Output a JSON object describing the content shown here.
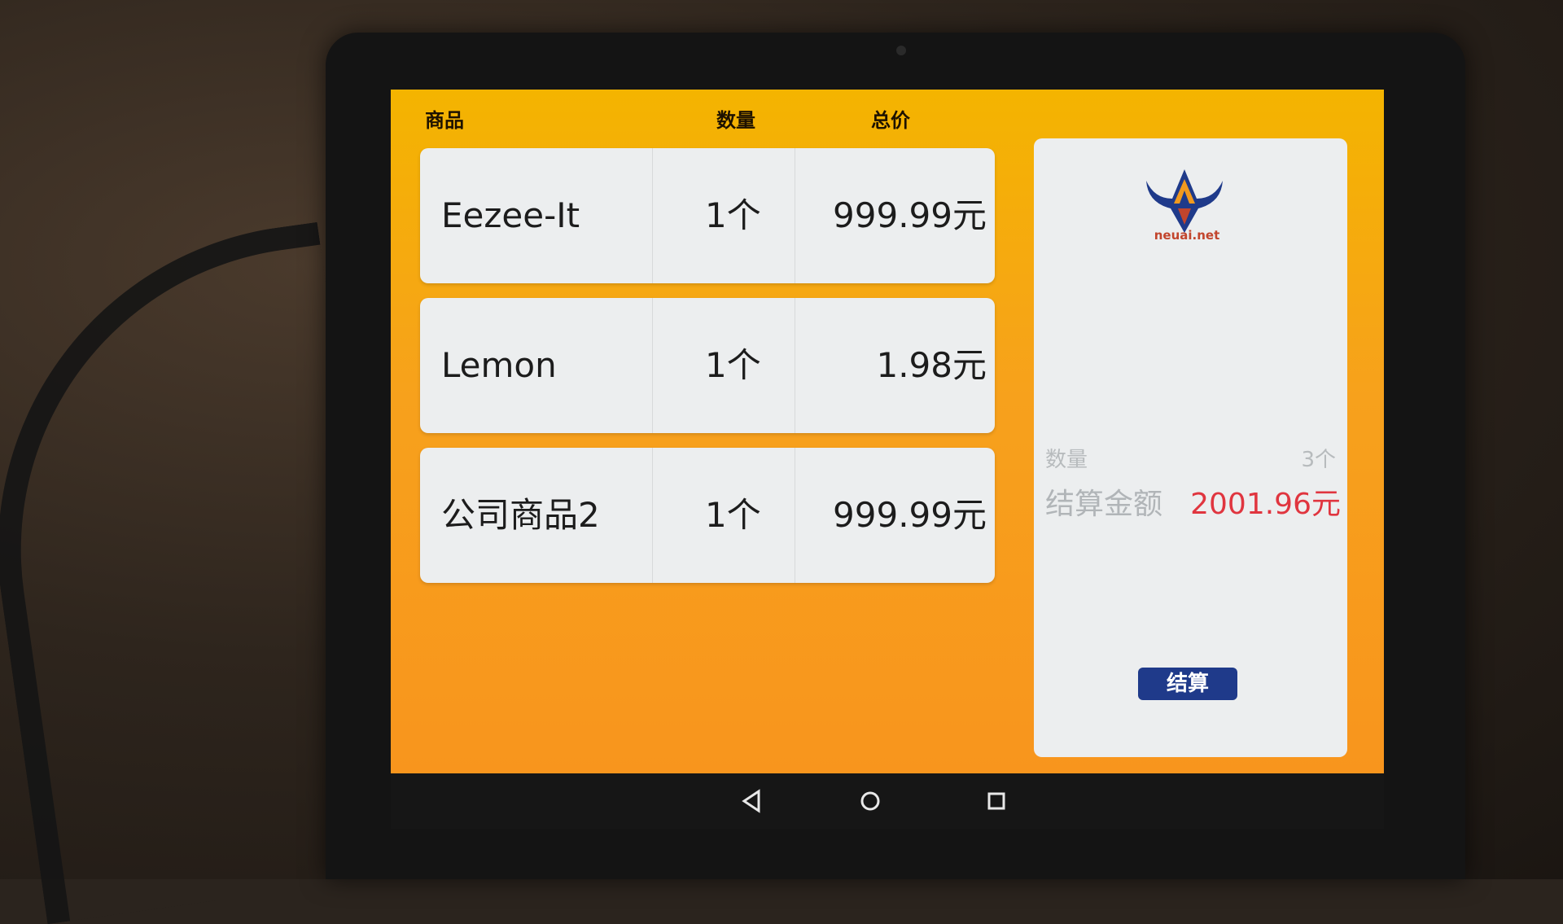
{
  "header": {
    "col_product": "商品",
    "col_quantity": "数量",
    "col_total": "总价"
  },
  "items": [
    {
      "name": "Eezee-It",
      "qty": "1个",
      "total": "999.99元"
    },
    {
      "name": "Lemon",
      "qty": "1个",
      "total": "1.98元"
    },
    {
      "name": "公司商品2",
      "qty": "1个",
      "total": "999.99元"
    }
  ],
  "summary": {
    "logo_text": "neuai.net",
    "quantity_label": "数量",
    "quantity_value": "3个",
    "amount_label": "结算金额",
    "amount_value": "2001.96元",
    "checkout_label": "结算"
  },
  "colors": {
    "screen_top": "#f4b400",
    "screen_bottom": "#f8951d",
    "card_bg": "#eceeef",
    "amount_color": "#e0353f",
    "button_color": "#1f3a8a"
  },
  "navbar": {
    "icons": [
      "back-icon",
      "home-icon",
      "recent-apps-icon"
    ]
  }
}
